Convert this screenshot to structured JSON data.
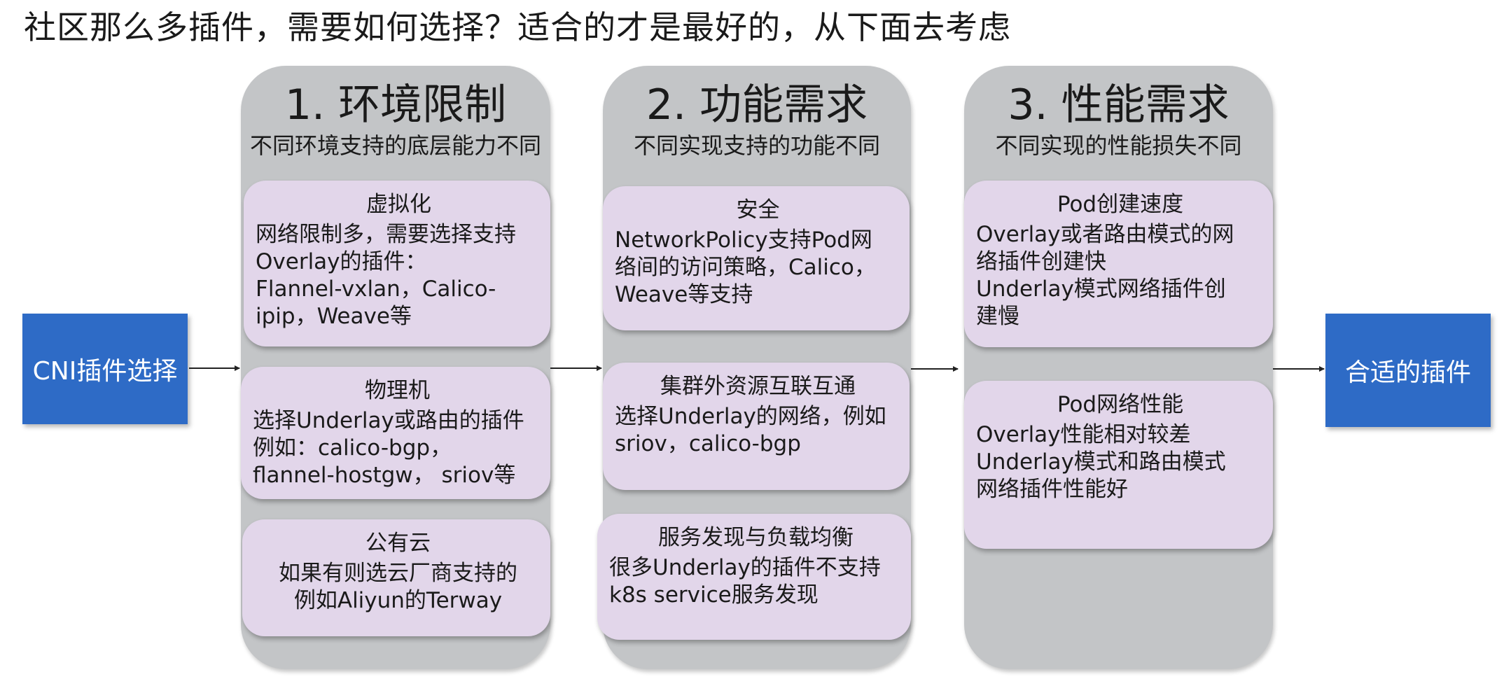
{
  "title": "社区那么多插件，需要如何选择？适合的才是最好的，从下面去考虑",
  "start": {
    "label": "CNI插件选择"
  },
  "end": {
    "label": "合适的插件"
  },
  "columns": [
    {
      "title": "1. 环境限制",
      "subtitle": "不同环境支持的底层能力不同",
      "cards": [
        {
          "title": "虚拟化",
          "body": "网络限制多，需要选择支持\nOverlay的插件：\nFlannel-vxlan，Calico-\nipip，Weave等"
        },
        {
          "title": "物理机",
          "body": "选择Underlay或路由的插件\n例如：calico-bgp，\nflannel-hostgw， sriov等"
        },
        {
          "title": "公有云",
          "body": "如果有则选云厂商支持的\n例如Aliyun的Terway"
        }
      ]
    },
    {
      "title": "2. 功能需求",
      "subtitle": "不同实现支持的功能不同",
      "cards": [
        {
          "title": "安全",
          "body": "NetworkPolicy支持Pod网\n络间的访问策略，Calico，\nWeave等支持"
        },
        {
          "title": "集群外资源互联互通",
          "body": "选择Underlay的网络，例如\nsriov，calico-bgp"
        },
        {
          "title": "服务发现与负载均衡",
          "body": "很多Underlay的插件不支持\nk8s service服务发现"
        }
      ]
    },
    {
      "title": "3. 性能需求",
      "subtitle": "不同实现的性能损失不同",
      "cards": [
        {
          "title": "Pod创建速度",
          "body": "Overlay或者路由模式的网\n络插件创建快\nUnderlay模式网络插件创\n建慢"
        },
        {
          "title": "Pod网络性能",
          "body": "Overlay性能相对较差\nUnderlay模式和路由模式\n网络插件性能好"
        }
      ]
    }
  ],
  "colors": {
    "accent_box": "#2e6bc6",
    "column_bg": "#c3c5c7",
    "card_bg": "#e2d6ea",
    "arrow": "#222222"
  }
}
